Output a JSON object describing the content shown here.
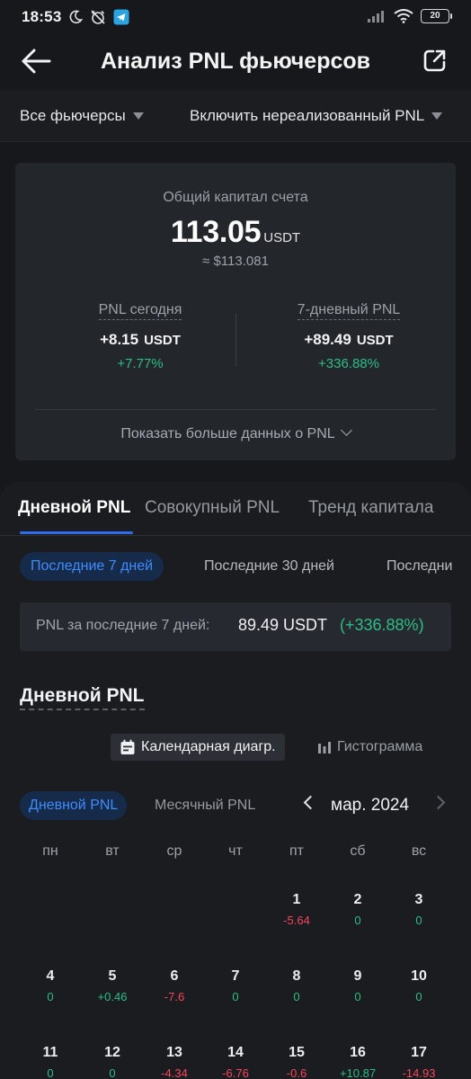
{
  "status_bar": {
    "time": "18:53",
    "battery": "20"
  },
  "header": {
    "title": "Анализ PNL фьючерсов"
  },
  "filters": {
    "contract": "Все фьючерсы",
    "unrealized": "Включить нереализованный PNL"
  },
  "account": {
    "label": "Общий капитал счета",
    "value": "113.05",
    "unit": "USDT",
    "approx": "≈ $113.081",
    "today": {
      "label": "PNL сегодня",
      "value": "+8.15",
      "unit": "USDT",
      "percent": "+7.77%"
    },
    "week": {
      "label": "7-дневный PNL",
      "value": "+89.49",
      "unit": "USDT",
      "percent": "+336.88%"
    },
    "more": "Показать больше данных о PNL"
  },
  "tabs": [
    "Дневной PNL",
    "Совокупный PNL",
    "Тренд капитала"
  ],
  "ranges": [
    "Последние 7 дней",
    "Последние 30 дней",
    "Последни"
  ],
  "summary": {
    "label": "PNL за последние 7 дней:",
    "value": "89.49 USDT",
    "percent": "(+336.88%)"
  },
  "section_title": "Дневной PNL",
  "view_toggle": {
    "calendar": "Календарная диагр.",
    "histogram": "Гистограмма"
  },
  "period": {
    "daily": "Дневной PNL",
    "monthly": "Месячный PNL",
    "month": "мар. 2024"
  },
  "weekdays": [
    "пн",
    "вт",
    "ср",
    "чт",
    "пт",
    "сб",
    "вс"
  ],
  "calendar": [
    {
      "day": "1",
      "pnl": "-5.64",
      "sign": "neg",
      "col": 4,
      "row": 0
    },
    {
      "day": "2",
      "pnl": "0",
      "sign": "pos",
      "col": 5,
      "row": 0
    },
    {
      "day": "3",
      "pnl": "0",
      "sign": "pos",
      "col": 6,
      "row": 0
    },
    {
      "day": "4",
      "pnl": "0",
      "sign": "pos",
      "col": 0,
      "row": 1
    },
    {
      "day": "5",
      "pnl": "+0.46",
      "sign": "pos",
      "col": 1,
      "row": 1
    },
    {
      "day": "6",
      "pnl": "-7.6",
      "sign": "neg",
      "col": 2,
      "row": 1
    },
    {
      "day": "7",
      "pnl": "0",
      "sign": "pos",
      "col": 3,
      "row": 1
    },
    {
      "day": "8",
      "pnl": "0",
      "sign": "pos",
      "col": 4,
      "row": 1
    },
    {
      "day": "9",
      "pnl": "0",
      "sign": "pos",
      "col": 5,
      "row": 1
    },
    {
      "day": "10",
      "pnl": "0",
      "sign": "pos",
      "col": 6,
      "row": 1
    },
    {
      "day": "11",
      "pnl": "0",
      "sign": "pos",
      "col": 0,
      "row": 2
    },
    {
      "day": "12",
      "pnl": "0",
      "sign": "pos",
      "col": 1,
      "row": 2
    },
    {
      "day": "13",
      "pnl": "-4.34",
      "sign": "neg",
      "col": 2,
      "row": 2
    },
    {
      "day": "14",
      "pnl": "-6.76",
      "sign": "neg",
      "col": 3,
      "row": 2
    },
    {
      "day": "15",
      "pnl": "-0.6",
      "sign": "neg",
      "col": 4,
      "row": 2
    },
    {
      "day": "16",
      "pnl": "+10.87",
      "sign": "pos",
      "col": 5,
      "row": 2
    },
    {
      "day": "17",
      "pnl": "-14.93",
      "sign": "neg",
      "col": 6,
      "row": 2
    }
  ],
  "colors": {
    "accent": "#2f6bed",
    "positive": "#2ebd85",
    "negative": "#f6465d",
    "background": "#16181c"
  }
}
